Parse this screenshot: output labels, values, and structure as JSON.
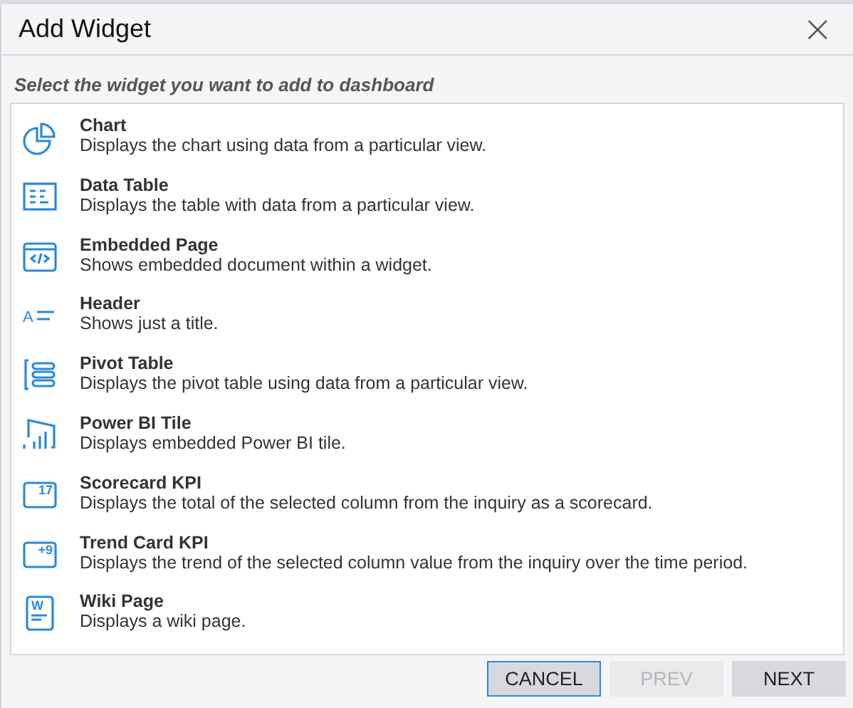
{
  "dialog": {
    "title": "Add Widget",
    "close": "×"
  },
  "instruction": "Select the widget you want to add to dashboard",
  "widgets": [
    {
      "kind": "chart",
      "name": "Chart",
      "description": "Displays the chart using data from a particular view."
    },
    {
      "kind": "table",
      "name": "Data Table",
      "description": "Displays the table with data from a particular view."
    },
    {
      "kind": "embed",
      "name": "Embedded Page",
      "description": "Shows embedded document within a widget."
    },
    {
      "kind": "header",
      "icon_text": "A",
      "name": "Header",
      "description": "Shows just a title."
    },
    {
      "kind": "pivot",
      "name": "Pivot Table",
      "description": "Displays the pivot table using data from a particular view."
    },
    {
      "kind": "tile",
      "name": "Power BI Tile",
      "description": "Displays embedded Power BI tile."
    },
    {
      "kind": "card",
      "icon_text": "17",
      "name": "Scorecard KPI",
      "description": "Displays the total of the selected column from the inquiry as a scorecard."
    },
    {
      "kind": "card",
      "icon_text": "+9",
      "name": "Trend Card KPI",
      "description": "Displays the trend of the selected column value from the inquiry over the time period."
    },
    {
      "kind": "doc",
      "icon_text": "W",
      "name": "Wiki Page",
      "description": "Displays a wiki page."
    }
  ],
  "buttons": [
    {
      "label": "CANCEL",
      "focused": true,
      "disabled": false
    },
    {
      "label": "PREV",
      "focused": false,
      "disabled": true
    },
    {
      "label": "NEXT",
      "focused": false,
      "disabled": false
    }
  ]
}
